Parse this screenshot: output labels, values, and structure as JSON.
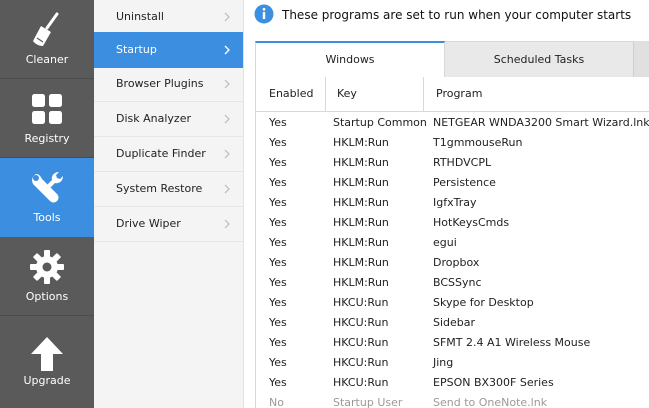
{
  "sidebar": {
    "items": [
      {
        "label": "Cleaner",
        "icon": "broom-icon",
        "active": false
      },
      {
        "label": "Registry",
        "icon": "grid-icon",
        "active": false
      },
      {
        "label": "Tools",
        "icon": "wrench-icon",
        "active": true
      },
      {
        "label": "Options",
        "icon": "gear-icon",
        "active": false
      },
      {
        "label": "Upgrade",
        "icon": "arrow-up-icon",
        "active": false
      }
    ]
  },
  "submenu": {
    "items": [
      {
        "label": "Uninstall"
      },
      {
        "label": "Startup"
      },
      {
        "label": "Browser Plugins"
      },
      {
        "label": "Disk Analyzer"
      },
      {
        "label": "Duplicate Finder"
      },
      {
        "label": "System Restore"
      },
      {
        "label": "Drive Wiper"
      }
    ],
    "active_index": 1
  },
  "info": {
    "icon": "info-icon",
    "text": "These programs are set to run when your computer starts"
  },
  "tabs": {
    "windows": "Windows",
    "scheduled": "Scheduled Tasks"
  },
  "table": {
    "headers": {
      "enabled": "Enabled",
      "key": "Key",
      "program": "Program"
    },
    "rows": [
      {
        "enabled": "Yes",
        "key": "Startup Common",
        "program": "NETGEAR WNDA3200 Smart Wizard.lnk"
      },
      {
        "enabled": "Yes",
        "key": "HKLM:Run",
        "program": "T1gmmouseRun"
      },
      {
        "enabled": "Yes",
        "key": "HKLM:Run",
        "program": "RTHDVCPL"
      },
      {
        "enabled": "Yes",
        "key": "HKLM:Run",
        "program": "Persistence"
      },
      {
        "enabled": "Yes",
        "key": "HKLM:Run",
        "program": "IgfxTray"
      },
      {
        "enabled": "Yes",
        "key": "HKLM:Run",
        "program": "HotKeysCmds"
      },
      {
        "enabled": "Yes",
        "key": "HKLM:Run",
        "program": "egui"
      },
      {
        "enabled": "Yes",
        "key": "HKLM:Run",
        "program": "Dropbox"
      },
      {
        "enabled": "Yes",
        "key": "HKLM:Run",
        "program": "BCSSync"
      },
      {
        "enabled": "Yes",
        "key": "HKCU:Run",
        "program": "Skype for Desktop"
      },
      {
        "enabled": "Yes",
        "key": "HKCU:Run",
        "program": "Sidebar"
      },
      {
        "enabled": "Yes",
        "key": "HKCU:Run",
        "program": "SFMT 2.4 A1 Wireless Mouse"
      },
      {
        "enabled": "Yes",
        "key": "HKCU:Run",
        "program": "Jing"
      },
      {
        "enabled": "Yes",
        "key": "HKCU:Run",
        "program": "EPSON BX300F Series"
      },
      {
        "enabled": "No",
        "key": "Startup User",
        "program": "Send to OneNote.lnk"
      }
    ]
  },
  "colors": {
    "accent": "#3c8fe0",
    "sidebar_bg": "#5a5a5a",
    "disabled_text": "#9a9a9a"
  }
}
